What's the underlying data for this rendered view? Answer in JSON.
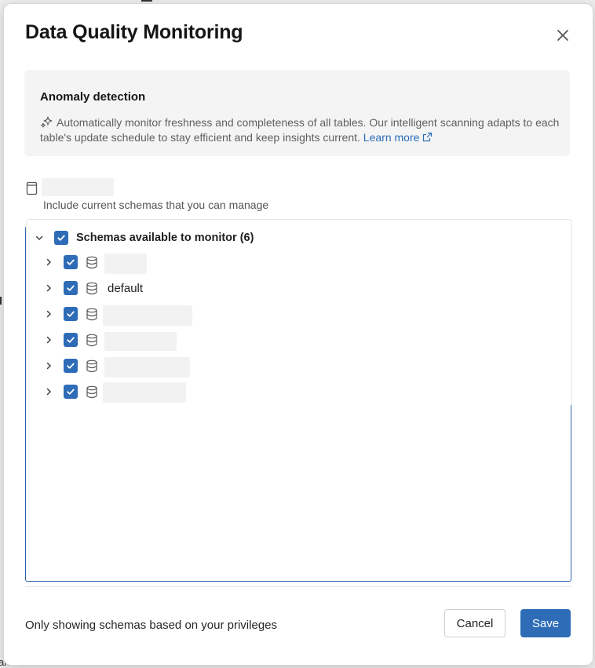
{
  "modal": {
    "title": "Data Quality Monitoring",
    "close_icon": "close-icon"
  },
  "info_panel": {
    "heading": "Anomaly detection",
    "icon": "sparkle-icon",
    "body": "Automatically monitor freshness and completeness of all tables. Our intelligent scanning adapts to each table's update schedule to stay efficient and keep insights current.",
    "link_label": "Learn more",
    "link_icon": "external-link-icon"
  },
  "catalog": {
    "icon": "catalog-icon",
    "subtext": "Include current schemas that you can manage"
  },
  "tree": {
    "root_label": "Schemas available to monitor (6)",
    "root_checked": true,
    "items": [
      {
        "label": "",
        "checked": true,
        "icon": "database-icon"
      },
      {
        "label": "default",
        "checked": true,
        "icon": "database-icon"
      },
      {
        "label": "",
        "checked": true,
        "icon": "database-icon"
      },
      {
        "label": "",
        "checked": true,
        "icon": "database-icon"
      },
      {
        "label": "",
        "checked": true,
        "icon": "database-icon"
      },
      {
        "label": "",
        "checked": true,
        "icon": "database-icon"
      }
    ]
  },
  "footer": {
    "note": "Only showing schemas based on your privileges",
    "cancel_label": "Cancel",
    "save_label": "Save"
  },
  "colors": {
    "accent": "#2e6cb7",
    "info_bg": "#f4f4f4"
  }
}
